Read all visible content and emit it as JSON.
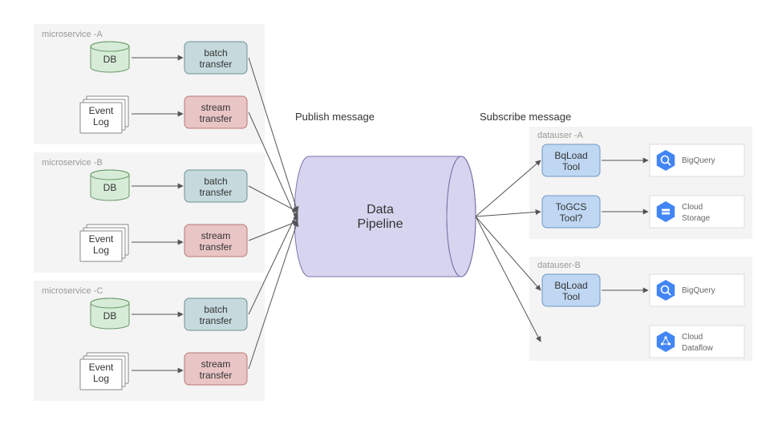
{
  "labels": {
    "publish": "Publish message",
    "subscribe": "Subscribe message",
    "pipeline1": "Data",
    "pipeline2": "Pipeline"
  },
  "microservices": [
    {
      "title": "microservice -A",
      "db": "DB",
      "eventlog": "Event\nLog",
      "batch": "batch\ntransfer",
      "stream": "stream\ntransfer"
    },
    {
      "title": "microservice -B",
      "db": "DB",
      "eventlog": "Event\nLog",
      "batch": "batch\ntransfer",
      "stream": "stream\ntransfer"
    },
    {
      "title": "microservice -C",
      "db": "DB",
      "eventlog": "Event\nLog",
      "batch": "batch\ntransfer",
      "stream": "stream\ntransfer"
    }
  ],
  "datausers": [
    {
      "title": "datauser -A",
      "tools": [
        {
          "label": "BqLoad\nTool"
        },
        {
          "label": "ToGCS\nTool?"
        }
      ],
      "services": [
        {
          "name": "BigQuery",
          "icon": "bq"
        },
        {
          "name": "Cloud\nStorage",
          "icon": "cs"
        }
      ]
    },
    {
      "title": "datauser-B",
      "tools": [
        {
          "label": "BqLoad\nTool"
        }
      ],
      "services": [
        {
          "name": "BigQuery",
          "icon": "bq"
        },
        {
          "name": "Cloud\nDataflow",
          "icon": "df"
        }
      ]
    }
  ]
}
